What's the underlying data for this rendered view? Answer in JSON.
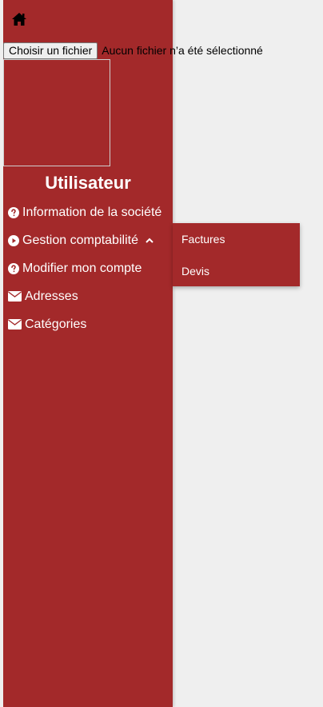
{
  "file_input": {
    "button_label": "Choisir un fichier",
    "status": "Aucun fichier n’a été sélectionné"
  },
  "user": {
    "name": "Utilisateur"
  },
  "menu": {
    "items": [
      {
        "label": "Information de la société",
        "icon": "question-circle-icon"
      },
      {
        "label": "Gestion comptabilité",
        "icon": "play-circle-icon",
        "expanded": true
      },
      {
        "label": "Modifier mon compte",
        "icon": "question-circle-icon"
      },
      {
        "label": "Adresses",
        "icon": "envelope-icon"
      },
      {
        "label": "Catégories",
        "icon": "envelope-icon"
      }
    ],
    "submenu": [
      {
        "label": "Factures"
      },
      {
        "label": "Devis"
      }
    ]
  },
  "colors": {
    "sidebar": "#a3292a",
    "page_background": "#efefef",
    "text": "#ffffff"
  }
}
